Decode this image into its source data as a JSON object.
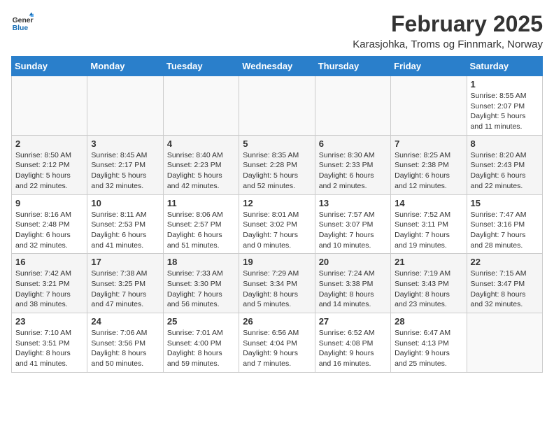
{
  "header": {
    "logo_line1": "General",
    "logo_line2": "Blue",
    "month": "February 2025",
    "location": "Karasjohka, Troms og Finnmark, Norway"
  },
  "weekdays": [
    "Sunday",
    "Monday",
    "Tuesday",
    "Wednesday",
    "Thursday",
    "Friday",
    "Saturday"
  ],
  "weeks": [
    [
      {
        "day": "",
        "info": ""
      },
      {
        "day": "",
        "info": ""
      },
      {
        "day": "",
        "info": ""
      },
      {
        "day": "",
        "info": ""
      },
      {
        "day": "",
        "info": ""
      },
      {
        "day": "",
        "info": ""
      },
      {
        "day": "1",
        "info": "Sunrise: 8:55 AM\nSunset: 2:07 PM\nDaylight: 5 hours\nand 11 minutes."
      }
    ],
    [
      {
        "day": "2",
        "info": "Sunrise: 8:50 AM\nSunset: 2:12 PM\nDaylight: 5 hours\nand 22 minutes."
      },
      {
        "day": "3",
        "info": "Sunrise: 8:45 AM\nSunset: 2:17 PM\nDaylight: 5 hours\nand 32 minutes."
      },
      {
        "day": "4",
        "info": "Sunrise: 8:40 AM\nSunset: 2:23 PM\nDaylight: 5 hours\nand 42 minutes."
      },
      {
        "day": "5",
        "info": "Sunrise: 8:35 AM\nSunset: 2:28 PM\nDaylight: 5 hours\nand 52 minutes."
      },
      {
        "day": "6",
        "info": "Sunrise: 8:30 AM\nSunset: 2:33 PM\nDaylight: 6 hours\nand 2 minutes."
      },
      {
        "day": "7",
        "info": "Sunrise: 8:25 AM\nSunset: 2:38 PM\nDaylight: 6 hours\nand 12 minutes."
      },
      {
        "day": "8",
        "info": "Sunrise: 8:20 AM\nSunset: 2:43 PM\nDaylight: 6 hours\nand 22 minutes."
      }
    ],
    [
      {
        "day": "9",
        "info": "Sunrise: 8:16 AM\nSunset: 2:48 PM\nDaylight: 6 hours\nand 32 minutes."
      },
      {
        "day": "10",
        "info": "Sunrise: 8:11 AM\nSunset: 2:53 PM\nDaylight: 6 hours\nand 41 minutes."
      },
      {
        "day": "11",
        "info": "Sunrise: 8:06 AM\nSunset: 2:57 PM\nDaylight: 6 hours\nand 51 minutes."
      },
      {
        "day": "12",
        "info": "Sunrise: 8:01 AM\nSunset: 3:02 PM\nDaylight: 7 hours\nand 0 minutes."
      },
      {
        "day": "13",
        "info": "Sunrise: 7:57 AM\nSunset: 3:07 PM\nDaylight: 7 hours\nand 10 minutes."
      },
      {
        "day": "14",
        "info": "Sunrise: 7:52 AM\nSunset: 3:11 PM\nDaylight: 7 hours\nand 19 minutes."
      },
      {
        "day": "15",
        "info": "Sunrise: 7:47 AM\nSunset: 3:16 PM\nDaylight: 7 hours\nand 28 minutes."
      }
    ],
    [
      {
        "day": "16",
        "info": "Sunrise: 7:42 AM\nSunset: 3:21 PM\nDaylight: 7 hours\nand 38 minutes."
      },
      {
        "day": "17",
        "info": "Sunrise: 7:38 AM\nSunset: 3:25 PM\nDaylight: 7 hours\nand 47 minutes."
      },
      {
        "day": "18",
        "info": "Sunrise: 7:33 AM\nSunset: 3:30 PM\nDaylight: 7 hours\nand 56 minutes."
      },
      {
        "day": "19",
        "info": "Sunrise: 7:29 AM\nSunset: 3:34 PM\nDaylight: 8 hours\nand 5 minutes."
      },
      {
        "day": "20",
        "info": "Sunrise: 7:24 AM\nSunset: 3:38 PM\nDaylight: 8 hours\nand 14 minutes."
      },
      {
        "day": "21",
        "info": "Sunrise: 7:19 AM\nSunset: 3:43 PM\nDaylight: 8 hours\nand 23 minutes."
      },
      {
        "day": "22",
        "info": "Sunrise: 7:15 AM\nSunset: 3:47 PM\nDaylight: 8 hours\nand 32 minutes."
      }
    ],
    [
      {
        "day": "23",
        "info": "Sunrise: 7:10 AM\nSunset: 3:51 PM\nDaylight: 8 hours\nand 41 minutes."
      },
      {
        "day": "24",
        "info": "Sunrise: 7:06 AM\nSunset: 3:56 PM\nDaylight: 8 hours\nand 50 minutes."
      },
      {
        "day": "25",
        "info": "Sunrise: 7:01 AM\nSunset: 4:00 PM\nDaylight: 8 hours\nand 59 minutes."
      },
      {
        "day": "26",
        "info": "Sunrise: 6:56 AM\nSunset: 4:04 PM\nDaylight: 9 hours\nand 7 minutes."
      },
      {
        "day": "27",
        "info": "Sunrise: 6:52 AM\nSunset: 4:08 PM\nDaylight: 9 hours\nand 16 minutes."
      },
      {
        "day": "28",
        "info": "Sunrise: 6:47 AM\nSunset: 4:13 PM\nDaylight: 9 hours\nand 25 minutes."
      },
      {
        "day": "",
        "info": ""
      }
    ]
  ]
}
